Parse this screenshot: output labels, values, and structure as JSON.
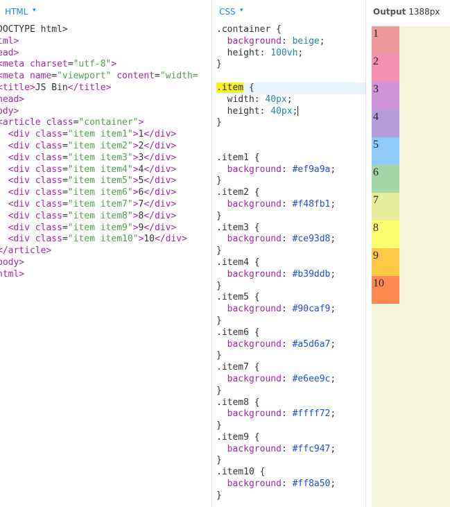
{
  "html_pane": {
    "title": "HTML",
    "lines": [
      [
        {
          "c": "txt",
          "t": "DOCTYPE html>"
        }
      ],
      [
        {
          "c": "tag",
          "t": "tml>"
        }
      ],
      [
        {
          "c": "tag",
          "t": "ead>"
        }
      ],
      [
        {
          "c": "tag",
          "t": "<meta"
        },
        {
          "c": "txt",
          "t": " "
        },
        {
          "c": "attr",
          "t": "charset"
        },
        {
          "c": "txt",
          "t": "="
        },
        {
          "c": "str",
          "t": "\"utf-8\""
        },
        {
          "c": "tag",
          "t": ">"
        }
      ],
      [
        {
          "c": "tag",
          "t": "<meta"
        },
        {
          "c": "txt",
          "t": " "
        },
        {
          "c": "attr",
          "t": "name"
        },
        {
          "c": "txt",
          "t": "="
        },
        {
          "c": "str",
          "t": "\"viewport\""
        },
        {
          "c": "txt",
          "t": " "
        },
        {
          "c": "attr",
          "t": "content"
        },
        {
          "c": "txt",
          "t": "="
        },
        {
          "c": "str",
          "t": "\"width="
        }
      ],
      [
        {
          "c": "tag",
          "t": "<title>"
        },
        {
          "c": "txt",
          "t": "JS Bin"
        },
        {
          "c": "tag",
          "t": "</title>"
        }
      ],
      [
        {
          "c": "tag",
          "t": "head>"
        }
      ],
      [
        {
          "c": "tag",
          "t": "ody>"
        }
      ],
      [
        {
          "c": "tag",
          "t": "<article"
        },
        {
          "c": "txt",
          "t": " "
        },
        {
          "c": "attr",
          "t": "class"
        },
        {
          "c": "txt",
          "t": "="
        },
        {
          "c": "str",
          "t": "\"container\""
        },
        {
          "c": "tag",
          "t": ">"
        }
      ],
      [
        {
          "c": "txt",
          "t": "  "
        },
        {
          "c": "tag",
          "t": "<div"
        },
        {
          "c": "txt",
          "t": " "
        },
        {
          "c": "attr",
          "t": "class"
        },
        {
          "c": "txt",
          "t": "="
        },
        {
          "c": "str",
          "t": "\"item item1\""
        },
        {
          "c": "tag",
          "t": ">"
        },
        {
          "c": "txt",
          "t": "1"
        },
        {
          "c": "tag",
          "t": "</div>"
        }
      ],
      [
        {
          "c": "txt",
          "t": "  "
        },
        {
          "c": "tag",
          "t": "<div"
        },
        {
          "c": "txt",
          "t": " "
        },
        {
          "c": "attr",
          "t": "class"
        },
        {
          "c": "txt",
          "t": "="
        },
        {
          "c": "str",
          "t": "\"item item2\""
        },
        {
          "c": "tag",
          "t": ">"
        },
        {
          "c": "txt",
          "t": "2"
        },
        {
          "c": "tag",
          "t": "</div>"
        }
      ],
      [
        {
          "c": "txt",
          "t": "  "
        },
        {
          "c": "tag",
          "t": "<div"
        },
        {
          "c": "txt",
          "t": " "
        },
        {
          "c": "attr",
          "t": "class"
        },
        {
          "c": "txt",
          "t": "="
        },
        {
          "c": "str",
          "t": "\"item item3\""
        },
        {
          "c": "tag",
          "t": ">"
        },
        {
          "c": "txt",
          "t": "3"
        },
        {
          "c": "tag",
          "t": "</div>"
        }
      ],
      [
        {
          "c": "txt",
          "t": "  "
        },
        {
          "c": "tag",
          "t": "<div"
        },
        {
          "c": "txt",
          "t": " "
        },
        {
          "c": "attr",
          "t": "class"
        },
        {
          "c": "txt",
          "t": "="
        },
        {
          "c": "str",
          "t": "\"item item4\""
        },
        {
          "c": "tag",
          "t": ">"
        },
        {
          "c": "txt",
          "t": "4"
        },
        {
          "c": "tag",
          "t": "</div>"
        }
      ],
      [
        {
          "c": "txt",
          "t": "  "
        },
        {
          "c": "tag",
          "t": "<div"
        },
        {
          "c": "txt",
          "t": " "
        },
        {
          "c": "attr",
          "t": "class"
        },
        {
          "c": "txt",
          "t": "="
        },
        {
          "c": "str",
          "t": "\"item item5\""
        },
        {
          "c": "tag",
          "t": ">"
        },
        {
          "c": "txt",
          "t": "5"
        },
        {
          "c": "tag",
          "t": "</div>"
        }
      ],
      [
        {
          "c": "txt",
          "t": "  "
        },
        {
          "c": "tag",
          "t": "<div"
        },
        {
          "c": "txt",
          "t": " "
        },
        {
          "c": "attr",
          "t": "class"
        },
        {
          "c": "txt",
          "t": "="
        },
        {
          "c": "str",
          "t": "\"item item6\""
        },
        {
          "c": "tag",
          "t": ">"
        },
        {
          "c": "txt",
          "t": "6"
        },
        {
          "c": "tag",
          "t": "</div>"
        }
      ],
      [
        {
          "c": "txt",
          "t": "  "
        },
        {
          "c": "tag",
          "t": "<div"
        },
        {
          "c": "txt",
          "t": " "
        },
        {
          "c": "attr",
          "t": "class"
        },
        {
          "c": "txt",
          "t": "="
        },
        {
          "c": "str",
          "t": "\"item item7\""
        },
        {
          "c": "tag",
          "t": ">"
        },
        {
          "c": "txt",
          "t": "7"
        },
        {
          "c": "tag",
          "t": "</div>"
        }
      ],
      [
        {
          "c": "txt",
          "t": "  "
        },
        {
          "c": "tag",
          "t": "<div"
        },
        {
          "c": "txt",
          "t": " "
        },
        {
          "c": "attr",
          "t": "class"
        },
        {
          "c": "txt",
          "t": "="
        },
        {
          "c": "str",
          "t": "\"item item8\""
        },
        {
          "c": "tag",
          "t": ">"
        },
        {
          "c": "txt",
          "t": "8"
        },
        {
          "c": "tag",
          "t": "</div>"
        }
      ],
      [
        {
          "c": "txt",
          "t": "  "
        },
        {
          "c": "tag",
          "t": "<div"
        },
        {
          "c": "txt",
          "t": " "
        },
        {
          "c": "attr",
          "t": "class"
        },
        {
          "c": "txt",
          "t": "="
        },
        {
          "c": "str",
          "t": "\"item item9\""
        },
        {
          "c": "tag",
          "t": ">"
        },
        {
          "c": "txt",
          "t": "9"
        },
        {
          "c": "tag",
          "t": "</div>"
        }
      ],
      [
        {
          "c": "txt",
          "t": "  "
        },
        {
          "c": "tag",
          "t": "<div"
        },
        {
          "c": "txt",
          "t": " "
        },
        {
          "c": "attr",
          "t": "class"
        },
        {
          "c": "txt",
          "t": "="
        },
        {
          "c": "str",
          "t": "\"item item10\""
        },
        {
          "c": "tag",
          "t": ">"
        },
        {
          "c": "txt",
          "t": "10"
        },
        {
          "c": "tag",
          "t": "</div>"
        }
      ],
      [
        {
          "c": "tag",
          "t": "</article>"
        }
      ],
      [
        {
          "c": "tag",
          "t": "body>"
        }
      ],
      [
        {
          "c": "tag",
          "t": "html>"
        }
      ]
    ]
  },
  "css_pane": {
    "title": "CSS",
    "active_line": 6,
    "lines": [
      [
        {
          "c": "sel",
          "t": ".container {"
        }
      ],
      [
        {
          "c": "txt",
          "t": "  "
        },
        {
          "c": "kw",
          "t": "background"
        },
        {
          "c": "txt",
          "t": ": "
        },
        {
          "c": "num",
          "t": "beige"
        },
        {
          "c": "txt",
          "t": ";"
        }
      ],
      [
        {
          "c": "txt",
          "t": "  height: "
        },
        {
          "c": "num",
          "t": "100vh"
        },
        {
          "c": "txt",
          "t": ";"
        }
      ],
      [
        {
          "c": "txt",
          "t": "}"
        }
      ],
      [
        {
          "c": "txt",
          "t": ""
        }
      ],
      [
        {
          "c": "hl",
          "t": ".item"
        },
        {
          "c": "txt",
          "t": " {"
        }
      ],
      [
        {
          "c": "txt",
          "t": "  width: "
        },
        {
          "c": "num",
          "t": "40px"
        },
        {
          "c": "txt",
          "t": ";"
        }
      ],
      [
        {
          "c": "txt",
          "t": "  height: "
        },
        {
          "c": "num",
          "t": "40px"
        },
        {
          "c": "txt",
          "t": ";"
        },
        {
          "c": "cursor",
          "t": ""
        }
      ],
      [
        {
          "c": "txt",
          "t": "}"
        }
      ],
      [
        {
          "c": "txt",
          "t": ""
        }
      ],
      [
        {
          "c": "txt",
          "t": ""
        }
      ],
      [
        {
          "c": "sel",
          "t": ".item1 {"
        }
      ],
      [
        {
          "c": "txt",
          "t": "  "
        },
        {
          "c": "kw",
          "t": "background"
        },
        {
          "c": "txt",
          "t": ": "
        },
        {
          "c": "col",
          "t": "#ef9a9a"
        },
        {
          "c": "txt",
          "t": ";"
        }
      ],
      [
        {
          "c": "txt",
          "t": "}"
        }
      ],
      [
        {
          "c": "sel",
          "t": ".item2 {"
        }
      ],
      [
        {
          "c": "txt",
          "t": "  "
        },
        {
          "c": "kw",
          "t": "background"
        },
        {
          "c": "txt",
          "t": ": "
        },
        {
          "c": "col",
          "t": "#f48fb1"
        },
        {
          "c": "txt",
          "t": ";"
        }
      ],
      [
        {
          "c": "txt",
          "t": "}"
        }
      ],
      [
        {
          "c": "sel",
          "t": ".item3 {"
        }
      ],
      [
        {
          "c": "txt",
          "t": "  "
        },
        {
          "c": "kw",
          "t": "background"
        },
        {
          "c": "txt",
          "t": ": "
        },
        {
          "c": "col",
          "t": "#ce93d8"
        },
        {
          "c": "txt",
          "t": ";"
        }
      ],
      [
        {
          "c": "txt",
          "t": "}"
        }
      ],
      [
        {
          "c": "sel",
          "t": ".item4 {"
        }
      ],
      [
        {
          "c": "txt",
          "t": "  "
        },
        {
          "c": "kw",
          "t": "background"
        },
        {
          "c": "txt",
          "t": ": "
        },
        {
          "c": "col",
          "t": "#b39ddb"
        },
        {
          "c": "txt",
          "t": ";"
        }
      ],
      [
        {
          "c": "txt",
          "t": "}"
        }
      ],
      [
        {
          "c": "sel",
          "t": ".item5 {"
        }
      ],
      [
        {
          "c": "txt",
          "t": "  "
        },
        {
          "c": "kw",
          "t": "background"
        },
        {
          "c": "txt",
          "t": ": "
        },
        {
          "c": "col",
          "t": "#90caf9"
        },
        {
          "c": "txt",
          "t": ";"
        }
      ],
      [
        {
          "c": "txt",
          "t": "}"
        }
      ],
      [
        {
          "c": "sel",
          "t": ".item6 {"
        }
      ],
      [
        {
          "c": "txt",
          "t": "  "
        },
        {
          "c": "kw",
          "t": "background"
        },
        {
          "c": "txt",
          "t": ": "
        },
        {
          "c": "col",
          "t": "#a5d6a7"
        },
        {
          "c": "txt",
          "t": ";"
        }
      ],
      [
        {
          "c": "txt",
          "t": "}"
        }
      ],
      [
        {
          "c": "sel",
          "t": ".item7 {"
        }
      ],
      [
        {
          "c": "txt",
          "t": "  "
        },
        {
          "c": "kw",
          "t": "background"
        },
        {
          "c": "txt",
          "t": ": "
        },
        {
          "c": "col",
          "t": "#e6ee9c"
        },
        {
          "c": "txt",
          "t": ";"
        }
      ],
      [
        {
          "c": "txt",
          "t": "}"
        }
      ],
      [
        {
          "c": "sel",
          "t": ".item8 {"
        }
      ],
      [
        {
          "c": "txt",
          "t": "  "
        },
        {
          "c": "kw",
          "t": "background"
        },
        {
          "c": "txt",
          "t": ": "
        },
        {
          "c": "col",
          "t": "#ffff72"
        },
        {
          "c": "txt",
          "t": ";"
        }
      ],
      [
        {
          "c": "txt",
          "t": "}"
        }
      ],
      [
        {
          "c": "sel",
          "t": ".item9 {"
        }
      ],
      [
        {
          "c": "txt",
          "t": "  "
        },
        {
          "c": "kw",
          "t": "background"
        },
        {
          "c": "txt",
          "t": ": "
        },
        {
          "c": "col",
          "t": "#ffc947"
        },
        {
          "c": "txt",
          "t": ";"
        }
      ],
      [
        {
          "c": "txt",
          "t": "}"
        }
      ],
      [
        {
          "c": "sel",
          "t": ".item10 {"
        }
      ],
      [
        {
          "c": "txt",
          "t": "  "
        },
        {
          "c": "kw",
          "t": "background"
        },
        {
          "c": "txt",
          "t": ": "
        },
        {
          "c": "col",
          "t": "#ff8a50"
        },
        {
          "c": "txt",
          "t": ";"
        }
      ],
      [
        {
          "c": "txt",
          "t": "}"
        }
      ]
    ]
  },
  "output_pane": {
    "title": "Output",
    "width_label": "1388px",
    "container_color": "#f5f5dc",
    "items": [
      {
        "label": "1",
        "color": "#ef9a9a"
      },
      {
        "label": "2",
        "color": "#f48fb1"
      },
      {
        "label": "3",
        "color": "#ce93d8"
      },
      {
        "label": "4",
        "color": "#b39ddb"
      },
      {
        "label": "5",
        "color": "#90caf9"
      },
      {
        "label": "6",
        "color": "#a5d6a7"
      },
      {
        "label": "7",
        "color": "#e6ee9c"
      },
      {
        "label": "8",
        "color": "#ffff72"
      },
      {
        "label": "9",
        "color": "#ffc947"
      },
      {
        "label": "10",
        "color": "#ff8a50"
      }
    ]
  }
}
